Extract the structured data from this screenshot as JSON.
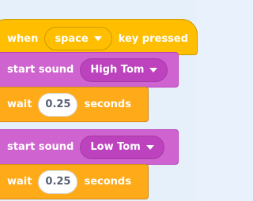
{
  "blocks": {
    "hat": {
      "prefix": "when",
      "key_value": "space",
      "suffix": "key pressed"
    },
    "sound1": {
      "label": "start sound",
      "sound_value": "High Tom"
    },
    "wait1": {
      "label": "wait",
      "value": "0.25",
      "suffix": "seconds"
    },
    "sound2": {
      "label": "start sound",
      "sound_value": "Low Tom"
    },
    "wait2": {
      "label": "wait",
      "value": "0.25",
      "suffix": "seconds"
    }
  },
  "icons": {
    "dropdown": "caret-down-icon"
  },
  "colors": {
    "events": "#ffbf00",
    "sound": "#cf63cf",
    "control": "#ffab19",
    "workspace": "#e9f1fc"
  }
}
